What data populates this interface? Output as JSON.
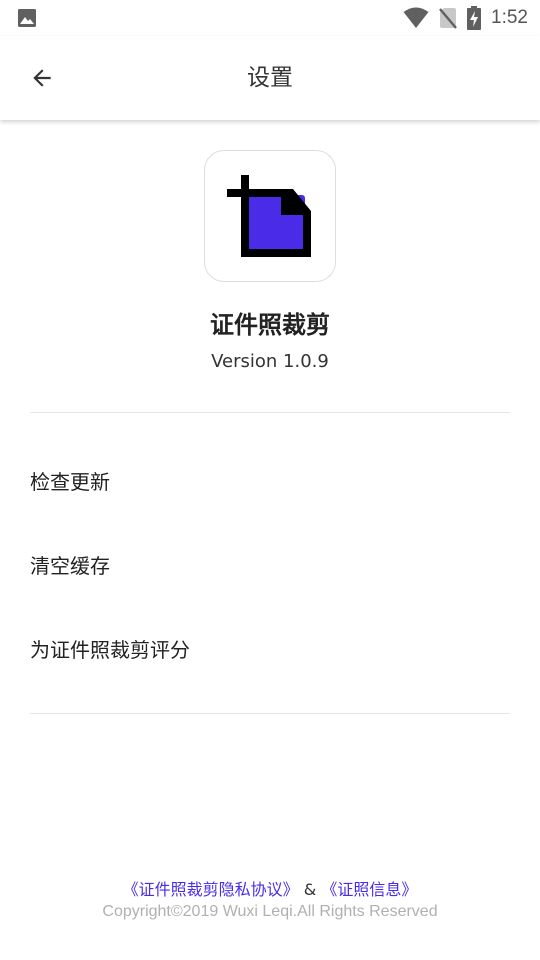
{
  "status_bar": {
    "time": "1:52",
    "icons": [
      "image-icon",
      "wifi-icon",
      "no-sim-icon",
      "battery-charging-icon"
    ]
  },
  "app_bar": {
    "title": "设置",
    "back_icon": "arrow-back-icon"
  },
  "app_info": {
    "logo_icon": "crop-icon",
    "name": "证件照裁剪",
    "version": "Version 1.0.9",
    "accent_color": "#4a2be8"
  },
  "menu": {
    "items": [
      {
        "label": "检查更新"
      },
      {
        "label": "清空缓存"
      },
      {
        "label": "为证件照裁剪评分"
      }
    ]
  },
  "footer": {
    "privacy_link": "《证件照裁剪隐私协议》",
    "separator": "&",
    "info_link": "《证照信息》",
    "copyright": "Copyright©2019 Wuxi Leqi.All Rights Reserved"
  }
}
